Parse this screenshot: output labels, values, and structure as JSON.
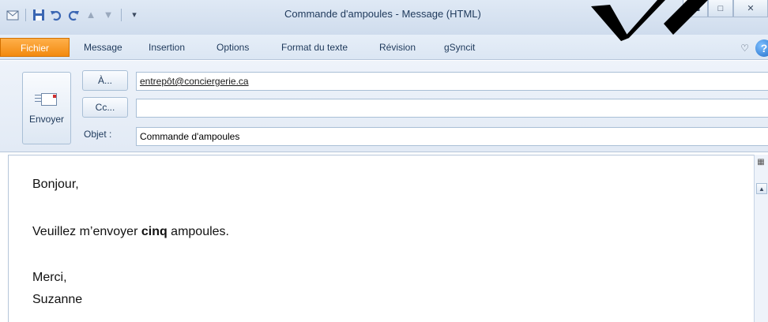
{
  "window": {
    "title": "Commande d'ampoules  -  Message (HTML)"
  },
  "quick_access": {
    "icons": [
      "outlook-icon",
      "save-icon",
      "undo-icon",
      "redo-icon",
      "up-icon",
      "down-icon",
      "customize-icon"
    ]
  },
  "ribbon": {
    "tabs": [
      {
        "label": "Fichier"
      },
      {
        "label": "Message"
      },
      {
        "label": "Insertion"
      },
      {
        "label": "Options"
      },
      {
        "label": "Format du texte"
      },
      {
        "label": "Révision"
      },
      {
        "label": "gSyncit"
      }
    ],
    "help_glyph": "?"
  },
  "compose": {
    "send_label": "Envoyer",
    "to_button": "À...",
    "cc_button": "Cc...",
    "subject_label": "Objet :",
    "to_value": "entrepôt@conciergerie.ca",
    "cc_value": "",
    "subject_value": "Commande d'ampoules"
  },
  "body": {
    "greeting": "Bonjour,",
    "line_before": "Veuillez m’envoyer ",
    "line_bold": "cinq",
    "line_after": " ampoules.",
    "closing": "Merci,",
    "signature": "Suzanne"
  },
  "colors": {
    "file_tab": "#f28a10",
    "ribbon_bg": "#dbe6f3"
  }
}
